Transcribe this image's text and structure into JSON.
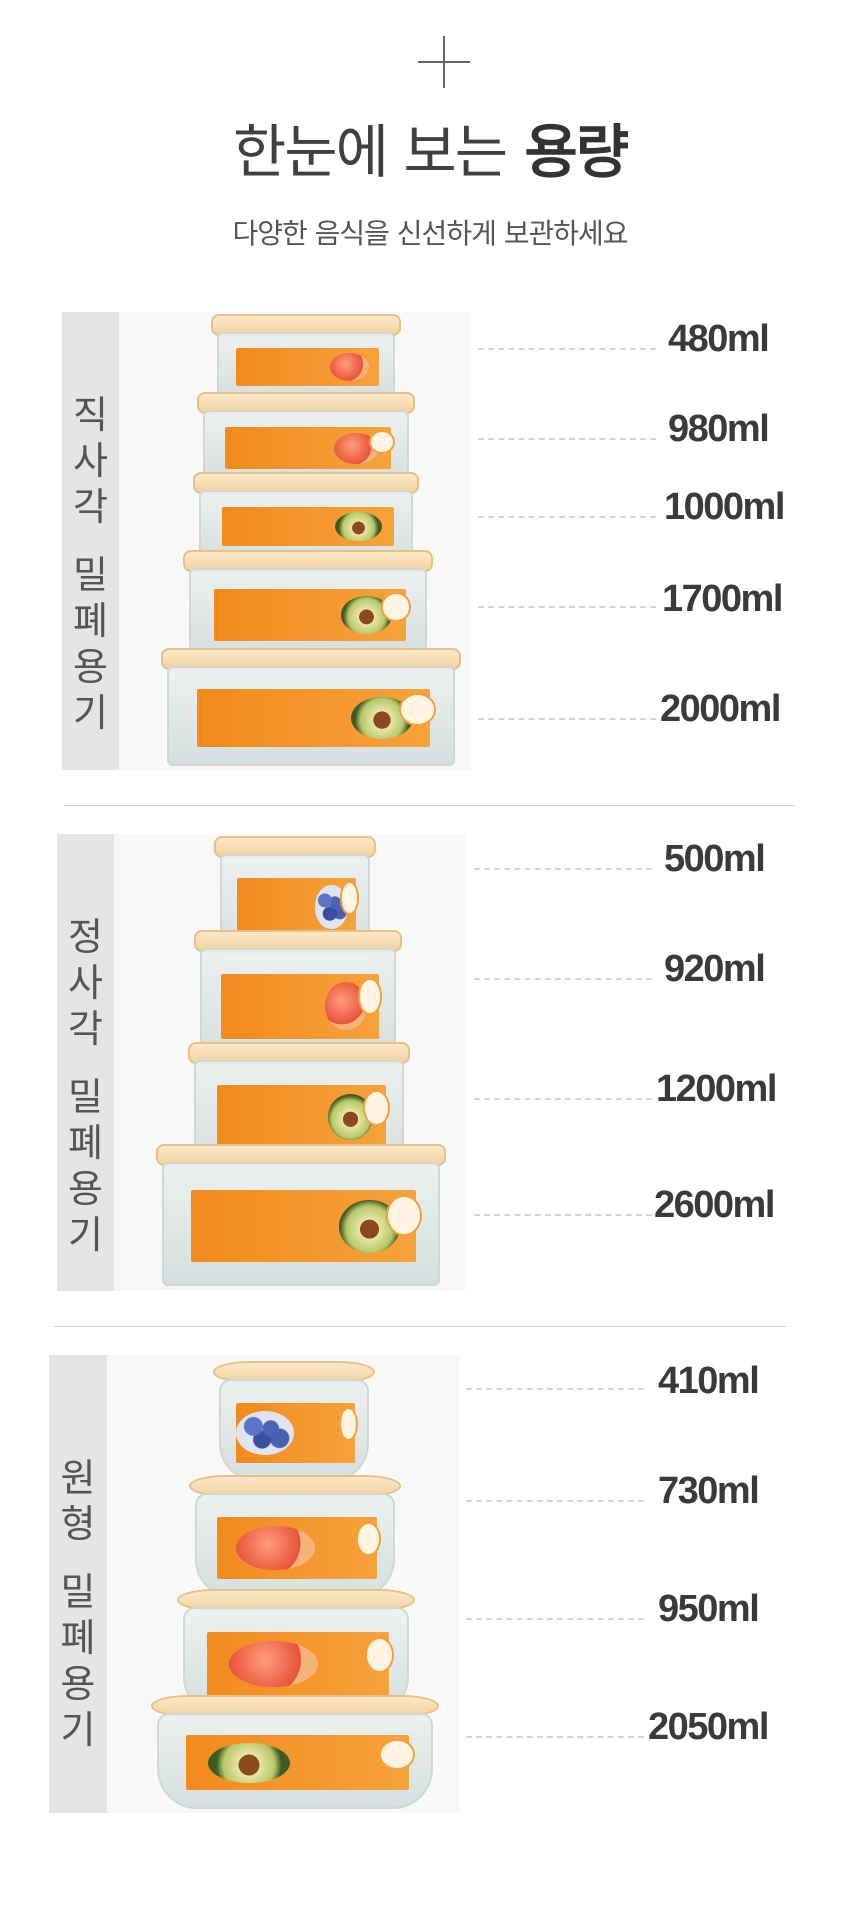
{
  "header": {
    "title_light": "한눈에 보는",
    "title_bold": "용량",
    "subtitle": "다양한 음식을 신선하게 보관하세요"
  },
  "sections": [
    {
      "label_line1": "직사각",
      "label_line2": "밀폐용기",
      "capacities": [
        "480ml",
        "980ml",
        "1000ml",
        "1700ml",
        "2000ml"
      ]
    },
    {
      "label_line1": "정사각",
      "label_line2": "밀폐용기",
      "capacities": [
        "500ml",
        "920ml",
        "1200ml",
        "2600ml"
      ]
    },
    {
      "label_line1": "원형",
      "label_line2": "밀폐용기",
      "capacities": [
        "410ml",
        "730ml",
        "950ml",
        "2050ml"
      ]
    }
  ],
  "colors": {
    "label_bg": "#e6e4e4",
    "sticker_orange": "#f28a1d",
    "lid_peach": "#f3d3a0",
    "text_dark": "#3a3a3a"
  }
}
